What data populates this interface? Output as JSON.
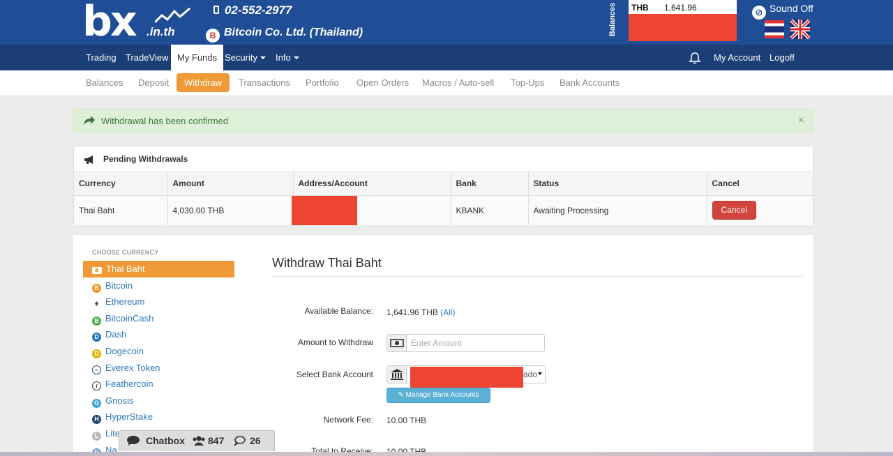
{
  "header": {
    "logo_main": "bx",
    "logo_sub": ".in.th",
    "phone": "02-552-2977",
    "company": "Bitcoin Co. Ltd. (Thailand)",
    "balances_label": "Balances",
    "balance_currency": "THB",
    "balance_amount": "1,641.96",
    "sound_label": "Sound Off"
  },
  "nav": {
    "items": [
      "Trading",
      "TradeView",
      "My Funds",
      "Security",
      "Info"
    ],
    "account": "My Account",
    "logoff": "Logoff"
  },
  "subnav": {
    "items": [
      "Balances",
      "Deposit",
      "Withdraw",
      "Transactions",
      "Portfolio",
      "Open Orders",
      "Macros / Auto-sell",
      "Top-Ups",
      "Bank Accounts"
    ]
  },
  "alert": {
    "message": "Withdrawal has been confirmed",
    "close": "×"
  },
  "pending": {
    "title": "Pending Withdrawals",
    "columns": [
      "Currency",
      "Amount",
      "Address/Account",
      "Bank",
      "Status",
      "Cancel"
    ],
    "rows": [
      {
        "currency": "Thai Baht",
        "amount": "4,030.00 THB",
        "bank": "KBANK",
        "status": "Awaiting Processing",
        "cancel": "Cancel"
      }
    ]
  },
  "sidebar": {
    "title": "CHOOSE CURRENCY",
    "currencies": [
      "Thai Baht",
      "Bitcoin",
      "Ethereum",
      "BitcoinCash",
      "Dash",
      "Dogecoin",
      "Everex Token",
      "Feathercoin",
      "Gnosis",
      "HyperStake",
      "Lite",
      "Na"
    ]
  },
  "form": {
    "title": "Withdraw Thai Baht",
    "available_label": "Available Balance:",
    "available_value": "1,641.96 THB",
    "all_link": "(All)",
    "amount_label": "Amount to Withdraw",
    "amount_placeholder": "Enter Amount",
    "bank_label": "Select Bank Account",
    "bank_value_tail": "ado",
    "manage_button": "Manage Bank Accounts",
    "fee_label": "Network Fee:",
    "fee_value": "10.00 THB",
    "receive_label": "Total to Receive:",
    "receive_value": "10.00 THB"
  },
  "chatbox": {
    "label": "Chatbox",
    "users": "847",
    "messages": "26"
  },
  "colors": {
    "header_blue": "#1f4e96",
    "nav_blue": "#1b3f76",
    "accent_orange": "#ef9a36",
    "cancel_red": "#d0443b",
    "link_blue": "#2e7ab8"
  }
}
